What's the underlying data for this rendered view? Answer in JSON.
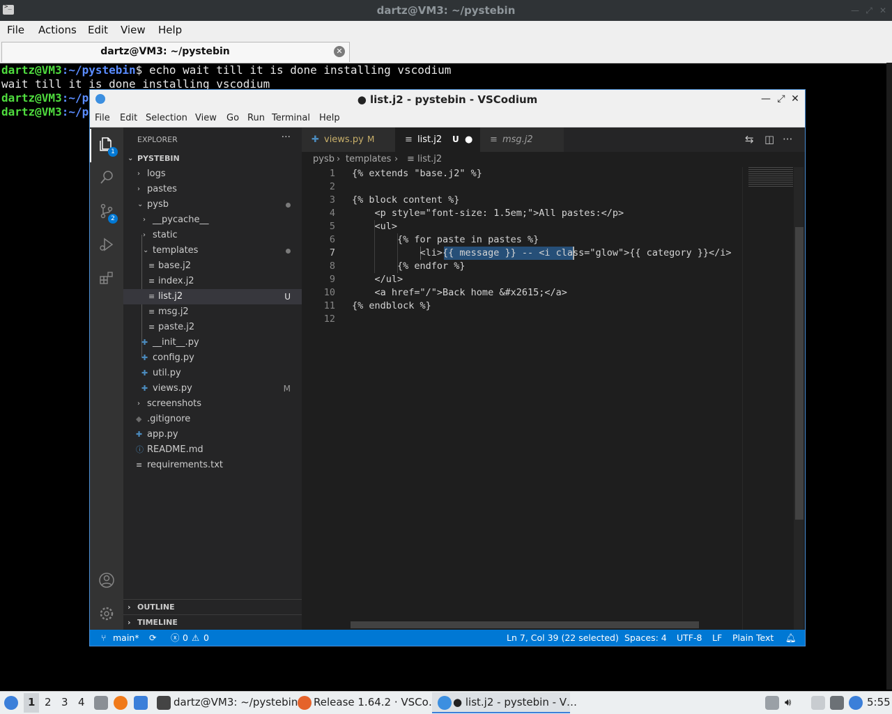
{
  "terminal": {
    "window_title": "dartz@VM3: ~/pystebin",
    "menu": [
      "File",
      "Actions",
      "Edit",
      "View",
      "Help"
    ],
    "tab_label": "dartz@VM3: ~/pystebin",
    "lines": [
      {
        "user": "dartz@VM3",
        "path": ":~/pystebin",
        "prompt": "$",
        "cmd": " echo wait till it is done installing vscodium"
      },
      {
        "output": "wait till it is done installing vscodium"
      },
      {
        "user": "dartz@VM3",
        "path": ":~/p"
      },
      {
        "user": "dartz@VM3",
        "path": ":~/p"
      }
    ]
  },
  "vscodium": {
    "window_title": "● list.j2 - pystebin - VSCodium",
    "menu": [
      "File",
      "Edit",
      "Selection",
      "View",
      "Go",
      "Run",
      "Terminal",
      "Help"
    ],
    "activity": {
      "explorer_badge": "1",
      "scm_badge": "2",
      "icons": [
        "files-icon",
        "search-icon",
        "source-control-icon",
        "run-debug-icon",
        "extensions-icon",
        "account-icon",
        "settings-gear-icon"
      ]
    },
    "explorer": {
      "header": "EXPLORER",
      "more": "···",
      "root": "PYSTEBIN",
      "items": [
        {
          "label": "logs",
          "status": ""
        },
        {
          "label": "pastes",
          "status": ""
        },
        {
          "label": "pysb",
          "status": "dot"
        },
        {
          "label": "__pycache__",
          "status": ""
        },
        {
          "label": "static",
          "status": ""
        },
        {
          "label": "templates",
          "status": "dot"
        },
        {
          "label": "base.j2",
          "status": ""
        },
        {
          "label": "index.j2",
          "status": ""
        },
        {
          "label": "list.j2",
          "status": "U"
        },
        {
          "label": "msg.j2",
          "status": ""
        },
        {
          "label": "paste.j2",
          "status": ""
        },
        {
          "label": "__init__.py",
          "status": ""
        },
        {
          "label": "config.py",
          "status": ""
        },
        {
          "label": "util.py",
          "status": ""
        },
        {
          "label": "views.py",
          "status": "M"
        },
        {
          "label": "screenshots",
          "status": ""
        },
        {
          "label": ".gitignore",
          "status": ""
        },
        {
          "label": "app.py",
          "status": ""
        },
        {
          "label": "README.md",
          "status": ""
        },
        {
          "label": "requirements.txt",
          "status": ""
        }
      ],
      "outline": "OUTLINE",
      "timeline": "TIMELINE"
    },
    "tabs": [
      {
        "label": "views.py",
        "badge": "M"
      },
      {
        "label": "list.j2",
        "badge": "U"
      },
      {
        "label": "msg.j2",
        "badge": ""
      }
    ],
    "breadcrumb": [
      "pysb",
      "templates",
      "list.j2"
    ],
    "code_lines": [
      "{% extends \"base.j2\" %}",
      "",
      "{% block content %}",
      "    <p style=\"font-size: 1.5em;\">All pastes:</p>",
      "    <ul>",
      "        {% for paste in pastes %}",
      "            <li>{{ message }} -- <i class=\"glow\">{{ category }}</i>",
      "        {% endfor %}",
      "    </ul>",
      "    <a href=\"/\">Back home &#x2615;</a>",
      "{% endblock %}",
      ""
    ],
    "line_numbers": [
      "1",
      "2",
      "3",
      "4",
      "5",
      "6",
      "7",
      "8",
      "9",
      "10",
      "11",
      "12"
    ],
    "status": {
      "branch": "main*",
      "errors": "0",
      "warnings": "0",
      "cursor": "Ln 7, Col 39 (22 selected)",
      "spaces": "Spaces: 4",
      "encoding": "UTF-8",
      "eol": "LF",
      "language": "Plain Text"
    }
  },
  "taskbar": {
    "workspaces": [
      "1",
      "2",
      "3",
      "4"
    ],
    "tasks": [
      "dartz@VM3: ~/pystebin",
      "Release 1.64.2 · VSCo…",
      "● list.j2 - pystebin - V…"
    ],
    "clock": "5:55"
  }
}
